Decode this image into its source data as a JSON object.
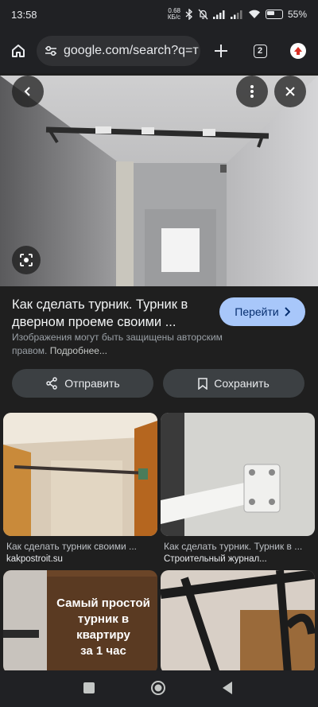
{
  "status": {
    "time": "13:58",
    "net_speed_value": "0.68",
    "net_speed_unit": "КБ/с",
    "battery": "55%"
  },
  "browser": {
    "url": "google.com/search?q=т",
    "tab_count": "2"
  },
  "result": {
    "title": "Как сделать турник. Турник в дверном проеме своими ...",
    "open_button": "Перейти",
    "copyright_text": "Изображения могут быть защищены авторским правом.",
    "more_link": "Подробнее..."
  },
  "actions": {
    "share": "Отправить",
    "save": "Сохранить"
  },
  "related": [
    {
      "caption": "Как сделать турник своими ...",
      "source": "kakpostroit.su"
    },
    {
      "caption": "Как сделать турник. Турник в ...",
      "source": "Строительный журнал..."
    },
    {
      "overlay_text": [
        "Самый простой",
        "турник в",
        "квартиру",
        "за 1 час"
      ]
    },
    {}
  ],
  "colors": {
    "accent_button": "#a8c7fa",
    "background": "#1f1f1f"
  }
}
